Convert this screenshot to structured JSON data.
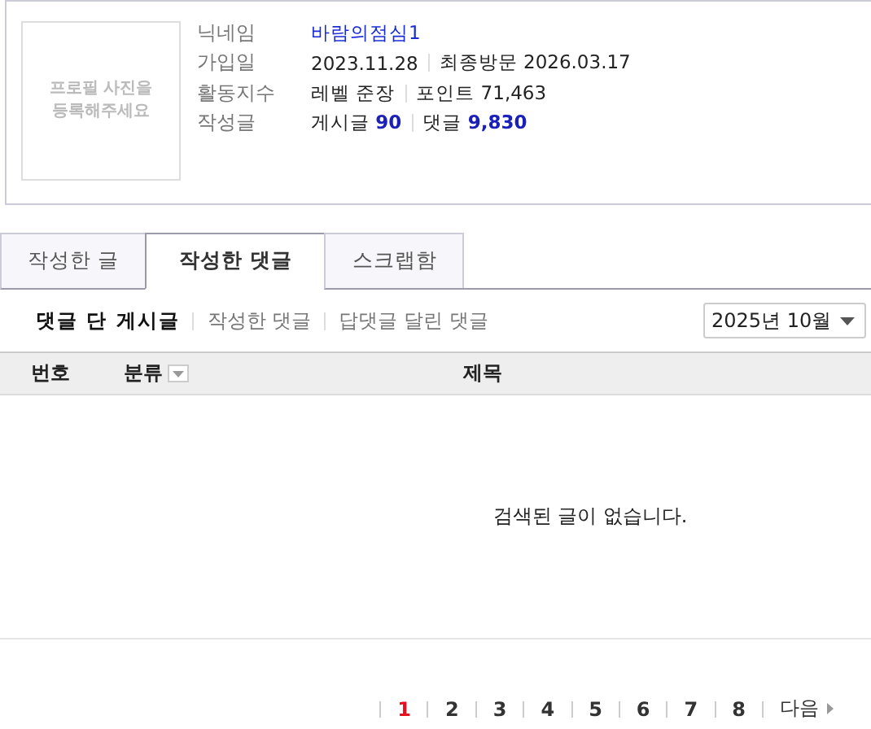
{
  "profile": {
    "photo_placeholder": "프로필 사진을 등록해주세요",
    "rows": [
      {
        "label": "닉네임",
        "kind": "link",
        "values": [
          "바람의점심1"
        ]
      },
      {
        "label": "가입일",
        "kind": "plain",
        "values": [
          "2023.11.28",
          "최종방문 2026.03.17"
        ]
      },
      {
        "label": "활동지수",
        "kind": "plain",
        "values": [
          "레벨 준장",
          "포인트 71,463"
        ]
      },
      {
        "label": "작성글",
        "kind": "plain",
        "values": [
          "게시글 **90**",
          "댓글 **9,830**"
        ]
      }
    ]
  },
  "tabs": [
    {
      "label": "작성한 글",
      "selected": false
    },
    {
      "label": "작성한 댓글",
      "selected": true
    },
    {
      "label": "스크랩함",
      "selected": false
    }
  ],
  "subtabs": [
    {
      "label": "댓글 단 게시글",
      "selected": true
    },
    {
      "label": "작성한 댓글",
      "selected": false
    },
    {
      "label": "답댓글 달린 댓글",
      "selected": false
    }
  ],
  "month_select": {
    "value": "2025년 10월"
  },
  "table": {
    "columns": [
      {
        "label": "번호",
        "filter": false
      },
      {
        "label": "분류",
        "filter": true
      },
      {
        "label": "제목",
        "filter": false
      }
    ],
    "empty_message": "검색된 글이 없습니다."
  },
  "pagination": {
    "pages": [
      {
        "label": "1",
        "selected": true
      },
      {
        "label": "2",
        "selected": false
      },
      {
        "label": "3",
        "selected": false
      },
      {
        "label": "4",
        "selected": false
      },
      {
        "label": "5",
        "selected": false
      },
      {
        "label": "6",
        "selected": false
      },
      {
        "label": "7",
        "selected": false
      },
      {
        "label": "8",
        "selected": false
      }
    ],
    "next": "다음"
  }
}
